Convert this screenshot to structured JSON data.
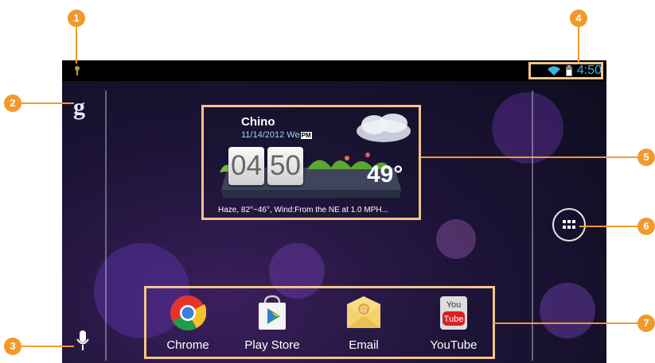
{
  "colors": {
    "accent_callout": "#f19a2b",
    "highlight_border": "#f1c48a",
    "status_icon": "#3fb2e6"
  },
  "status_bar": {
    "time": "4:50",
    "icons": [
      "notification-icon",
      "wifi-icon",
      "battery-icon"
    ]
  },
  "google_search": {
    "glyph": "g"
  },
  "weather_widget": {
    "city": "Chino",
    "date": "11/14/2012 We",
    "ampm": "PM",
    "hour": "04",
    "minute": "50",
    "temperature": "49°",
    "forecast": "Haze, 82°~46°, Wind:From the NE at 1.0 MPH..."
  },
  "dock": {
    "apps": [
      {
        "label": "Chrome",
        "icon": "chrome-icon"
      },
      {
        "label": "Play Store",
        "icon": "play-store-icon"
      },
      {
        "label": "Email",
        "icon": "email-icon"
      },
      {
        "label": "YouTube",
        "icon": "youtube-icon"
      }
    ],
    "youtube_icon_text": {
      "top": "You",
      "bottom": "Tube"
    }
  },
  "callouts": [
    "1",
    "2",
    "3",
    "4",
    "5",
    "6",
    "7"
  ]
}
